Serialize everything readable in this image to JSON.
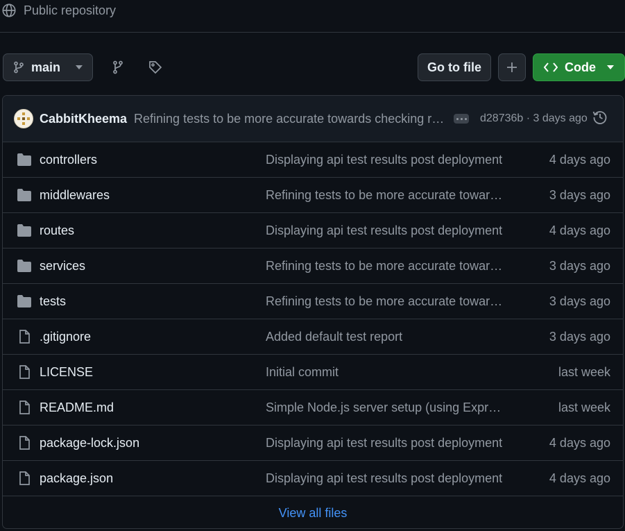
{
  "repo": {
    "visibility": "Public repository"
  },
  "toolbar": {
    "branch": "main",
    "goto_file": "Go to file",
    "add": "+",
    "code": "Code"
  },
  "latest_commit": {
    "author": "CabbitKheema",
    "message": "Refining tests to be more accurate towards checking resp...",
    "hash_time": "d28736b · 3 days ago"
  },
  "files": [
    {
      "type": "folder",
      "name": "controllers",
      "message": "Displaying api test results post deployment",
      "date": "4 days ago"
    },
    {
      "type": "folder",
      "name": "middlewares",
      "message": "Refining tests to be more accurate towards...",
      "date": "3 days ago"
    },
    {
      "type": "folder",
      "name": "routes",
      "message": "Displaying api test results post deployment",
      "date": "4 days ago"
    },
    {
      "type": "folder",
      "name": "services",
      "message": "Refining tests to be more accurate towards...",
      "date": "3 days ago"
    },
    {
      "type": "folder",
      "name": "tests",
      "message": "Refining tests to be more accurate towards...",
      "date": "3 days ago"
    },
    {
      "type": "file",
      "name": ".gitignore",
      "message": "Added default test report",
      "date": "3 days ago"
    },
    {
      "type": "file",
      "name": "LICENSE",
      "message": "Initial commit",
      "date": "last week"
    },
    {
      "type": "file",
      "name": "README.md",
      "message": "Simple Node.js server setup (using Express....",
      "date": "last week"
    },
    {
      "type": "file",
      "name": "package-lock.json",
      "message": "Displaying api test results post deployment",
      "date": "4 days ago"
    },
    {
      "type": "file",
      "name": "package.json",
      "message": "Displaying api test results post deployment",
      "date": "4 days ago"
    }
  ],
  "footer": {
    "view_all": "View all files"
  },
  "colors": {
    "background": "#0d1117",
    "accent_green": "#238636",
    "link_blue": "#4493f8"
  },
  "icons": [
    "globe-icon",
    "branch-icon",
    "branches-icon",
    "tag-icon",
    "caret-down-icon",
    "plus-icon",
    "code-icon",
    "kebab-icon",
    "history-icon",
    "folder-icon",
    "file-icon"
  ]
}
